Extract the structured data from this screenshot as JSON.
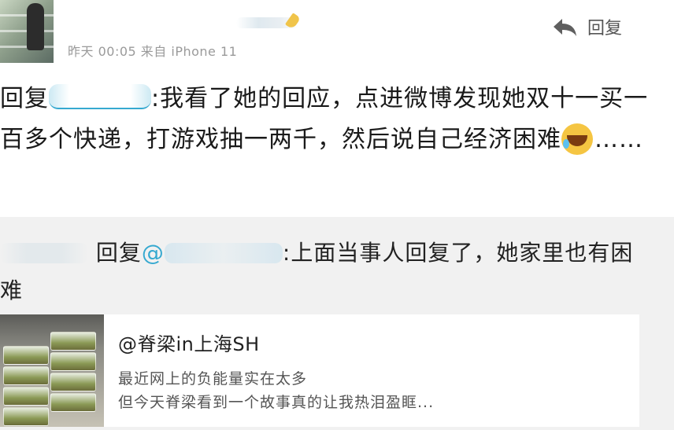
{
  "post": {
    "meta": "昨天 00:05 来自 iPhone 11",
    "reply_label": "回复"
  },
  "comment": {
    "prefix": "回复",
    "text": ":我看了她的回应，点进微博发现她双十一买一百多个快递，打游戏抽一两千，然后说自己经济困难",
    "suffix": "……"
  },
  "quoted": {
    "reply_word": "回复",
    "at": "@",
    "text": ":上面当事人回复了，她家里也有困难"
  },
  "card": {
    "title": "@脊梁in上海SH",
    "line1": "最近网上的负能量实在太多",
    "line2": "但今天脊梁看到一个故事真的让我热泪盈眶..."
  },
  "icons": {
    "reply": "reply-arrow-icon",
    "emoji": "laugh-cry-emoji-icon"
  },
  "colors": {
    "mention_accent": "#36a9d0",
    "meta_text": "#9a9a9a",
    "quote_bg": "#f1f1f1"
  }
}
